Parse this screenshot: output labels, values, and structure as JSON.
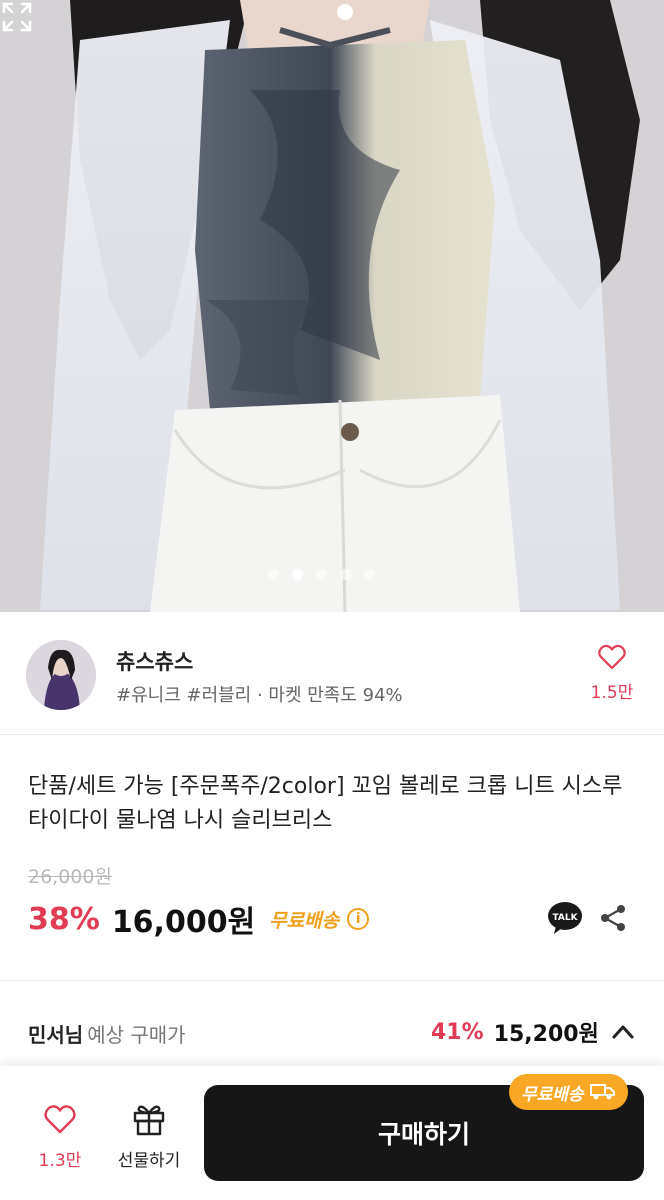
{
  "carousel": {
    "dot_count": 5,
    "active_index": 1
  },
  "seller": {
    "name": "츄스츄스",
    "tags": "#유니크 #러블리 · 마켓 만족도 94%",
    "like_count": "1.5만"
  },
  "product": {
    "title": "단품/세트 가능 [주문폭주/2color] 꼬임 볼레로 크롭 니트 시스루 타이다이 물나염 나시 슬리브리스",
    "original_price": "26,000원",
    "discount": "38%",
    "price": "16,000원",
    "free_shipping": "무료배송"
  },
  "expected": {
    "member_name": "민서님",
    "label": "예상 구매가",
    "discount": "41%",
    "price": "15,200원"
  },
  "bottom_bar": {
    "like_count": "1.3만",
    "gift_label": "선물하기",
    "buy_label": "구매하기",
    "badge_label": "무료배송"
  },
  "icons": {
    "talk": "talk-icon",
    "share": "share-icon",
    "heart": "heart-icon",
    "gift": "gift-icon",
    "chevron": "chevron-up-icon",
    "truck": "truck-icon",
    "expand": "expand-icon"
  },
  "colors": {
    "accent_red": "#e23c55",
    "shipping_orange": "#f0a11c",
    "buy_button": "#161616"
  }
}
